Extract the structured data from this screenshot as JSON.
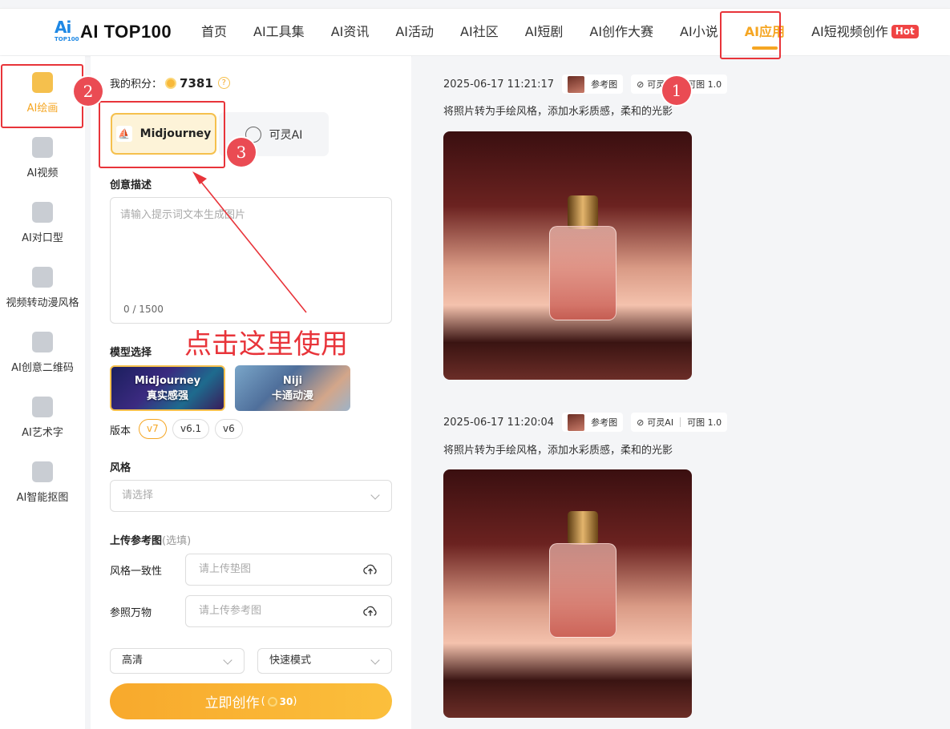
{
  "brand": {
    "mark": "Ai",
    "mark_sub": "TOP100",
    "name": "AI TOP100"
  },
  "nav": [
    {
      "label": "首页"
    },
    {
      "label": "AI工具集"
    },
    {
      "label": "AI资讯"
    },
    {
      "label": "AI活动"
    },
    {
      "label": "AI社区"
    },
    {
      "label": "AI短剧"
    },
    {
      "label": "AI创作大赛"
    },
    {
      "label": "AI小说"
    },
    {
      "label": "AI应用",
      "active": true
    },
    {
      "label": "AI短视频创作",
      "badge": "Hot"
    }
  ],
  "sidebar": [
    {
      "label": "AI绘画",
      "active": true,
      "icon": "image-icon"
    },
    {
      "label": "AI视频",
      "icon": "video-icon"
    },
    {
      "label": "AI对口型",
      "icon": "lips-icon"
    },
    {
      "label": "视频转动漫风格",
      "icon": "anime-icon"
    },
    {
      "label": "AI创意二维码",
      "icon": "qrcode-icon"
    },
    {
      "label": "AI艺术字",
      "icon": "art-text-icon"
    },
    {
      "label": "AI智能抠图",
      "icon": "cutout-icon"
    }
  ],
  "points": {
    "label": "我的积分：",
    "value": "7381",
    "help": "?"
  },
  "engines": {
    "midjourney": "Midjourney",
    "keling": "可灵AI"
  },
  "prompt": {
    "label": "创意描述",
    "placeholder": "请输入提示词文本生成图片",
    "counter": "0 / 1500"
  },
  "model": {
    "label": "模型选择",
    "cards": [
      {
        "title": "Midjourney",
        "subtitle": "真实感强"
      },
      {
        "title": "Niji",
        "subtitle": "卡通动漫"
      }
    ]
  },
  "version": {
    "label": "版本",
    "options": [
      "v7",
      "v6.1",
      "v6"
    ],
    "selected": "v7"
  },
  "style": {
    "label": "风格",
    "placeholder": "请选择"
  },
  "upload": {
    "label": "上传参考图",
    "optional": "(选填)",
    "style_ref_label": "风格一致性",
    "style_ref_placeholder": "请上传垫图",
    "obj_ref_label": "参照万物",
    "obj_ref_placeholder": "请上传参考图"
  },
  "quality": {
    "value": "高清"
  },
  "speed": {
    "value": "快速模式"
  },
  "submit": {
    "label": "立即创作",
    "cost_open": "(",
    "cost": "30",
    "cost_close": ")"
  },
  "annotation": {
    "text": "点击这里使用",
    "badges": [
      "1",
      "2",
      "3"
    ]
  },
  "results": [
    {
      "time": "2025-06-17 11:21:17",
      "ref": "参考图",
      "engine": "可灵AI",
      "model": "可图 1.0",
      "prompt": "将照片转为手绘风格，添加水彩质感，柔和的光影"
    },
    {
      "time": "2025-06-17 11:20:04",
      "ref": "参考图",
      "engine": "可灵AI",
      "model": "可图 1.0",
      "prompt": "将照片转为手绘风格，添加水彩质感，柔和的光影"
    }
  ],
  "colors": {
    "accent": "#f5a623",
    "annotation_red": "#e8343a",
    "badge_red": "#ea4b53"
  }
}
